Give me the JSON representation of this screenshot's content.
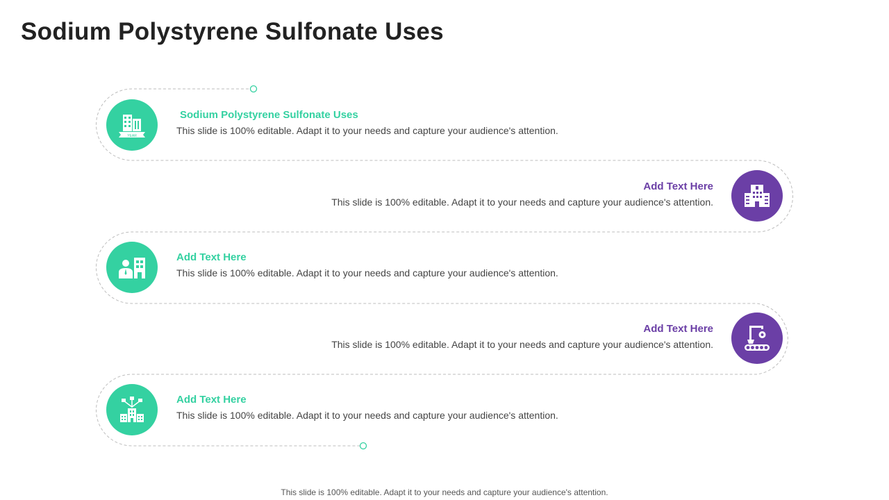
{
  "slide": {
    "title": "Sodium Polystyrene Sulfonate Uses",
    "footer": "This slide is 100% editable. Adapt it to your needs and capture your audience's attention.",
    "colors": {
      "green": "#34d1a1",
      "purple": "#6b3fa6",
      "title": "#222222"
    }
  },
  "items": [
    {
      "heading": "Sodium Polystyrene  Sulfonate Uses",
      "text": "This slide is 100% editable. Adapt it to your needs and capture your audience's attention.",
      "icon": "building-year-icon",
      "color": "green",
      "side": "left"
    },
    {
      "heading": "Add Text Here",
      "text": "This slide is 100% editable. Adapt it to your needs and capture your audience's attention.",
      "icon": "office-building-icon",
      "color": "purple",
      "side": "right"
    },
    {
      "heading": "Add Text Here",
      "text": "This slide is 100% editable. Adapt it to your needs and capture your audience's attention.",
      "icon": "person-building-icon",
      "color": "green",
      "side": "left"
    },
    {
      "heading": "Add Text Here",
      "text": "This slide is 100% editable. Adapt it to your needs and capture your audience's attention.",
      "icon": "factory-conveyor-icon",
      "color": "purple",
      "side": "right"
    },
    {
      "heading": "Add Text Here",
      "text": "This slide is 100% editable. Adapt it to your needs and capture your audience's attention.",
      "icon": "network-building-icon",
      "color": "green",
      "side": "left"
    }
  ]
}
